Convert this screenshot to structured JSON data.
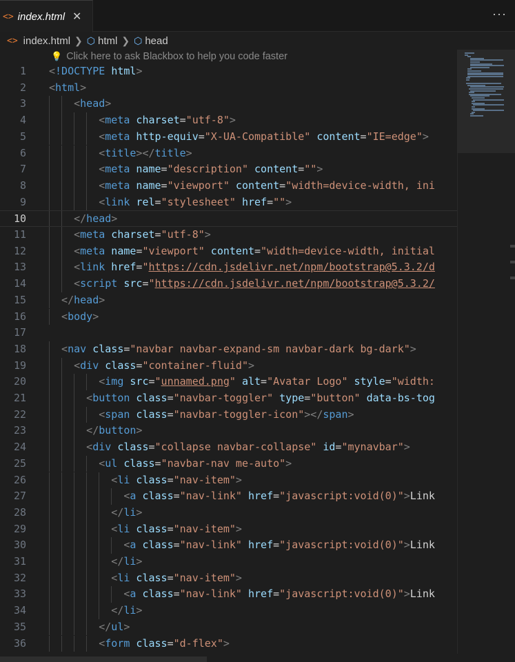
{
  "tab": {
    "icon": "html-file-icon",
    "name": "index.html",
    "close": "✕"
  },
  "more": "···",
  "breadcrumb": [
    "index.html",
    "html",
    "head"
  ],
  "hint": "Click here to ask Blackbox to help you code faster",
  "colors": {
    "tag": "#569cd6",
    "attribute": "#9cdcfe",
    "string": "#ce9178",
    "punctuation": "#808080",
    "text": "#d4d4d4",
    "file_icon": "#e37933"
  },
  "active_line": 10,
  "lines": [
    {
      "n": "1",
      "indent": 0,
      "tokens": [
        [
          "p",
          "<"
        ],
        [
          "t",
          "!DOCTYPE"
        ],
        [
          "d",
          " "
        ],
        [
          "a",
          "html"
        ],
        [
          "p",
          ">"
        ]
      ]
    },
    {
      "n": "2",
      "indent": 0,
      "tokens": [
        [
          "p",
          "<"
        ],
        [
          "t",
          "html"
        ],
        [
          "p",
          ">"
        ]
      ]
    },
    {
      "n": "3",
      "indent": 2,
      "tokens": [
        [
          "p",
          "<"
        ],
        [
          "t",
          "head"
        ],
        [
          "p",
          ">"
        ]
      ]
    },
    {
      "n": "4",
      "indent": 4,
      "tokens": [
        [
          "p",
          "<"
        ],
        [
          "t",
          "meta"
        ],
        [
          "d",
          " "
        ],
        [
          "a",
          "charset"
        ],
        [
          "d",
          "="
        ],
        [
          "v",
          "\"utf-8\""
        ],
        [
          "p",
          ">"
        ]
      ]
    },
    {
      "n": "5",
      "indent": 4,
      "tokens": [
        [
          "p",
          "<"
        ],
        [
          "t",
          "meta"
        ],
        [
          "d",
          " "
        ],
        [
          "a",
          "http-equiv"
        ],
        [
          "d",
          "="
        ],
        [
          "v",
          "\"X-UA-Compatible\""
        ],
        [
          "d",
          " "
        ],
        [
          "a",
          "content"
        ],
        [
          "d",
          "="
        ],
        [
          "v",
          "\"IE=edge\""
        ],
        [
          "p",
          ">"
        ]
      ]
    },
    {
      "n": "6",
      "indent": 4,
      "tokens": [
        [
          "p",
          "<"
        ],
        [
          "t",
          "title"
        ],
        [
          "p",
          "></"
        ],
        [
          "t",
          "title"
        ],
        [
          "p",
          ">"
        ]
      ]
    },
    {
      "n": "7",
      "indent": 4,
      "tokens": [
        [
          "p",
          "<"
        ],
        [
          "t",
          "meta"
        ],
        [
          "d",
          " "
        ],
        [
          "a",
          "name"
        ],
        [
          "d",
          "="
        ],
        [
          "v",
          "\"description\""
        ],
        [
          "d",
          " "
        ],
        [
          "a",
          "content"
        ],
        [
          "d",
          "="
        ],
        [
          "v",
          "\"\""
        ],
        [
          "p",
          ">"
        ]
      ]
    },
    {
      "n": "8",
      "indent": 4,
      "tokens": [
        [
          "p",
          "<"
        ],
        [
          "t",
          "meta"
        ],
        [
          "d",
          " "
        ],
        [
          "a",
          "name"
        ],
        [
          "d",
          "="
        ],
        [
          "v",
          "\"viewport\""
        ],
        [
          "d",
          " "
        ],
        [
          "a",
          "content"
        ],
        [
          "d",
          "="
        ],
        [
          "v",
          "\"width=device-width, ini"
        ]
      ]
    },
    {
      "n": "9",
      "indent": 4,
      "tokens": [
        [
          "p",
          "<"
        ],
        [
          "t",
          "link"
        ],
        [
          "d",
          " "
        ],
        [
          "a",
          "rel"
        ],
        [
          "d",
          "="
        ],
        [
          "v",
          "\"stylesheet\""
        ],
        [
          "d",
          " "
        ],
        [
          "a",
          "href"
        ],
        [
          "d",
          "="
        ],
        [
          "v",
          "\"\""
        ],
        [
          "p",
          ">"
        ]
      ]
    },
    {
      "n": "10",
      "indent": 2,
      "tokens": [
        [
          "p",
          "</"
        ],
        [
          "t",
          "head"
        ],
        [
          "p",
          ">"
        ]
      ]
    },
    {
      "n": "11",
      "indent": 2,
      "tokens": [
        [
          "p",
          "<"
        ],
        [
          "t",
          "meta"
        ],
        [
          "d",
          " "
        ],
        [
          "a",
          "charset"
        ],
        [
          "d",
          "="
        ],
        [
          "v",
          "\"utf-8\""
        ],
        [
          "p",
          ">"
        ]
      ]
    },
    {
      "n": "12",
      "indent": 2,
      "tokens": [
        [
          "p",
          "<"
        ],
        [
          "t",
          "meta"
        ],
        [
          "d",
          " "
        ],
        [
          "a",
          "name"
        ],
        [
          "d",
          "="
        ],
        [
          "v",
          "\"viewport\""
        ],
        [
          "d",
          " "
        ],
        [
          "a",
          "content"
        ],
        [
          "d",
          "="
        ],
        [
          "v",
          "\"width=device-width, initial"
        ]
      ]
    },
    {
      "n": "13",
      "indent": 2,
      "tokens": [
        [
          "p",
          "<"
        ],
        [
          "t",
          "link"
        ],
        [
          "d",
          " "
        ],
        [
          "a",
          "href"
        ],
        [
          "d",
          "="
        ],
        [
          "v",
          "\""
        ],
        [
          "vu",
          "https://cdn.jsdelivr.net/npm/bootstrap@5.3.2/d"
        ]
      ]
    },
    {
      "n": "14",
      "indent": 2,
      "tokens": [
        [
          "p",
          "<"
        ],
        [
          "t",
          "script"
        ],
        [
          "d",
          " "
        ],
        [
          "a",
          "src"
        ],
        [
          "d",
          "="
        ],
        [
          "v",
          "\""
        ],
        [
          "vu",
          "https://cdn.jsdelivr.net/npm/bootstrap@5.3.2/"
        ]
      ]
    },
    {
      "n": "15",
      "indent": 1,
      "tokens": [
        [
          "p",
          "</"
        ],
        [
          "t",
          "head"
        ],
        [
          "p",
          ">"
        ]
      ]
    },
    {
      "n": "16",
      "indent": 1,
      "tokens": [
        [
          "p",
          "<"
        ],
        [
          "t",
          "body"
        ],
        [
          "p",
          ">"
        ]
      ]
    },
    {
      "n": "17",
      "indent": 0,
      "tokens": []
    },
    {
      "n": "18",
      "indent": 1,
      "tokens": [
        [
          "p",
          "<"
        ],
        [
          "t",
          "nav"
        ],
        [
          "d",
          " "
        ],
        [
          "a",
          "class"
        ],
        [
          "d",
          "="
        ],
        [
          "v",
          "\"navbar navbar-expand-sm navbar-dark bg-dark\""
        ],
        [
          "p",
          ">"
        ]
      ]
    },
    {
      "n": "19",
      "indent": 2,
      "tokens": [
        [
          "p",
          "<"
        ],
        [
          "t",
          "div"
        ],
        [
          "d",
          " "
        ],
        [
          "a",
          "class"
        ],
        [
          "d",
          "="
        ],
        [
          "v",
          "\"container-fluid\""
        ],
        [
          "p",
          ">"
        ]
      ]
    },
    {
      "n": "20",
      "indent": 4,
      "tokens": [
        [
          "p",
          "<"
        ],
        [
          "t",
          "img"
        ],
        [
          "d",
          " "
        ],
        [
          "a",
          "src"
        ],
        [
          "d",
          "="
        ],
        [
          "v",
          "\""
        ],
        [
          "vu",
          "unnamed.png"
        ],
        [
          "v",
          "\""
        ],
        [
          "d",
          " "
        ],
        [
          "a",
          "alt"
        ],
        [
          "d",
          "="
        ],
        [
          "v",
          "\"Avatar Logo\""
        ],
        [
          "d",
          " "
        ],
        [
          "a",
          "style"
        ],
        [
          "d",
          "="
        ],
        [
          "v",
          "\"width:"
        ]
      ]
    },
    {
      "n": "21",
      "indent": 3,
      "tokens": [
        [
          "p",
          "<"
        ],
        [
          "t",
          "button"
        ],
        [
          "d",
          " "
        ],
        [
          "a",
          "class"
        ],
        [
          "d",
          "="
        ],
        [
          "v",
          "\"navbar-toggler\""
        ],
        [
          "d",
          " "
        ],
        [
          "a",
          "type"
        ],
        [
          "d",
          "="
        ],
        [
          "v",
          "\"button\""
        ],
        [
          "d",
          " "
        ],
        [
          "a",
          "data-bs-tog"
        ]
      ]
    },
    {
      "n": "22",
      "indent": 4,
      "tokens": [
        [
          "p",
          "<"
        ],
        [
          "t",
          "span"
        ],
        [
          "d",
          " "
        ],
        [
          "a",
          "class"
        ],
        [
          "d",
          "="
        ],
        [
          "v",
          "\"navbar-toggler-icon\""
        ],
        [
          "p",
          "></"
        ],
        [
          "t",
          "span"
        ],
        [
          "p",
          ">"
        ]
      ]
    },
    {
      "n": "23",
      "indent": 3,
      "tokens": [
        [
          "p",
          "</"
        ],
        [
          "t",
          "button"
        ],
        [
          "p",
          ">"
        ]
      ]
    },
    {
      "n": "24",
      "indent": 3,
      "tokens": [
        [
          "p",
          "<"
        ],
        [
          "t",
          "div"
        ],
        [
          "d",
          " "
        ],
        [
          "a",
          "class"
        ],
        [
          "d",
          "="
        ],
        [
          "v",
          "\"collapse navbar-collapse\""
        ],
        [
          "d",
          " "
        ],
        [
          "a",
          "id"
        ],
        [
          "d",
          "="
        ],
        [
          "v",
          "\"mynavbar\""
        ],
        [
          "p",
          ">"
        ]
      ]
    },
    {
      "n": "25",
      "indent": 4,
      "tokens": [
        [
          "p",
          "<"
        ],
        [
          "t",
          "ul"
        ],
        [
          "d",
          " "
        ],
        [
          "a",
          "class"
        ],
        [
          "d",
          "="
        ],
        [
          "v",
          "\"navbar-nav me-auto\""
        ],
        [
          "p",
          ">"
        ]
      ]
    },
    {
      "n": "26",
      "indent": 5,
      "tokens": [
        [
          "p",
          "<"
        ],
        [
          "t",
          "li"
        ],
        [
          "d",
          " "
        ],
        [
          "a",
          "class"
        ],
        [
          "d",
          "="
        ],
        [
          "v",
          "\"nav-item\""
        ],
        [
          "p",
          ">"
        ]
      ]
    },
    {
      "n": "27",
      "indent": 6,
      "tokens": [
        [
          "p",
          "<"
        ],
        [
          "t",
          "a"
        ],
        [
          "d",
          " "
        ],
        [
          "a",
          "class"
        ],
        [
          "d",
          "="
        ],
        [
          "v",
          "\"nav-link\""
        ],
        [
          "d",
          " "
        ],
        [
          "a",
          "href"
        ],
        [
          "d",
          "="
        ],
        [
          "v",
          "\"javascript:void(0)\""
        ],
        [
          "p",
          ">"
        ],
        [
          "d",
          "Link"
        ]
      ]
    },
    {
      "n": "28",
      "indent": 5,
      "tokens": [
        [
          "p",
          "</"
        ],
        [
          "t",
          "li"
        ],
        [
          "p",
          ">"
        ]
      ]
    },
    {
      "n": "29",
      "indent": 5,
      "tokens": [
        [
          "p",
          "<"
        ],
        [
          "t",
          "li"
        ],
        [
          "d",
          " "
        ],
        [
          "a",
          "class"
        ],
        [
          "d",
          "="
        ],
        [
          "v",
          "\"nav-item\""
        ],
        [
          "p",
          ">"
        ]
      ]
    },
    {
      "n": "30",
      "indent": 6,
      "tokens": [
        [
          "p",
          "<"
        ],
        [
          "t",
          "a"
        ],
        [
          "d",
          " "
        ],
        [
          "a",
          "class"
        ],
        [
          "d",
          "="
        ],
        [
          "v",
          "\"nav-link\""
        ],
        [
          "d",
          " "
        ],
        [
          "a",
          "href"
        ],
        [
          "d",
          "="
        ],
        [
          "v",
          "\"javascript:void(0)\""
        ],
        [
          "p",
          ">"
        ],
        [
          "d",
          "Link"
        ]
      ]
    },
    {
      "n": "31",
      "indent": 5,
      "tokens": [
        [
          "p",
          "</"
        ],
        [
          "t",
          "li"
        ],
        [
          "p",
          ">"
        ]
      ]
    },
    {
      "n": "32",
      "indent": 5,
      "tokens": [
        [
          "p",
          "<"
        ],
        [
          "t",
          "li"
        ],
        [
          "d",
          " "
        ],
        [
          "a",
          "class"
        ],
        [
          "d",
          "="
        ],
        [
          "v",
          "\"nav-item\""
        ],
        [
          "p",
          ">"
        ]
      ]
    },
    {
      "n": "33",
      "indent": 6,
      "tokens": [
        [
          "p",
          "<"
        ],
        [
          "t",
          "a"
        ],
        [
          "d",
          " "
        ],
        [
          "a",
          "class"
        ],
        [
          "d",
          "="
        ],
        [
          "v",
          "\"nav-link\""
        ],
        [
          "d",
          " "
        ],
        [
          "a",
          "href"
        ],
        [
          "d",
          "="
        ],
        [
          "v",
          "\"javascript:void(0)\""
        ],
        [
          "p",
          ">"
        ],
        [
          "d",
          "Link"
        ]
      ]
    },
    {
      "n": "34",
      "indent": 5,
      "tokens": [
        [
          "p",
          "</"
        ],
        [
          "t",
          "li"
        ],
        [
          "p",
          ">"
        ]
      ]
    },
    {
      "n": "35",
      "indent": 4,
      "tokens": [
        [
          "p",
          "</"
        ],
        [
          "t",
          "ul"
        ],
        [
          "p",
          ">"
        ]
      ]
    },
    {
      "n": "36",
      "indent": 4,
      "tokens": [
        [
          "p",
          "<"
        ],
        [
          "t",
          "form"
        ],
        [
          "d",
          " "
        ],
        [
          "a",
          "class"
        ],
        [
          "d",
          "="
        ],
        [
          "v",
          "\"d-flex\""
        ],
        [
          "p",
          ">"
        ]
      ]
    }
  ]
}
